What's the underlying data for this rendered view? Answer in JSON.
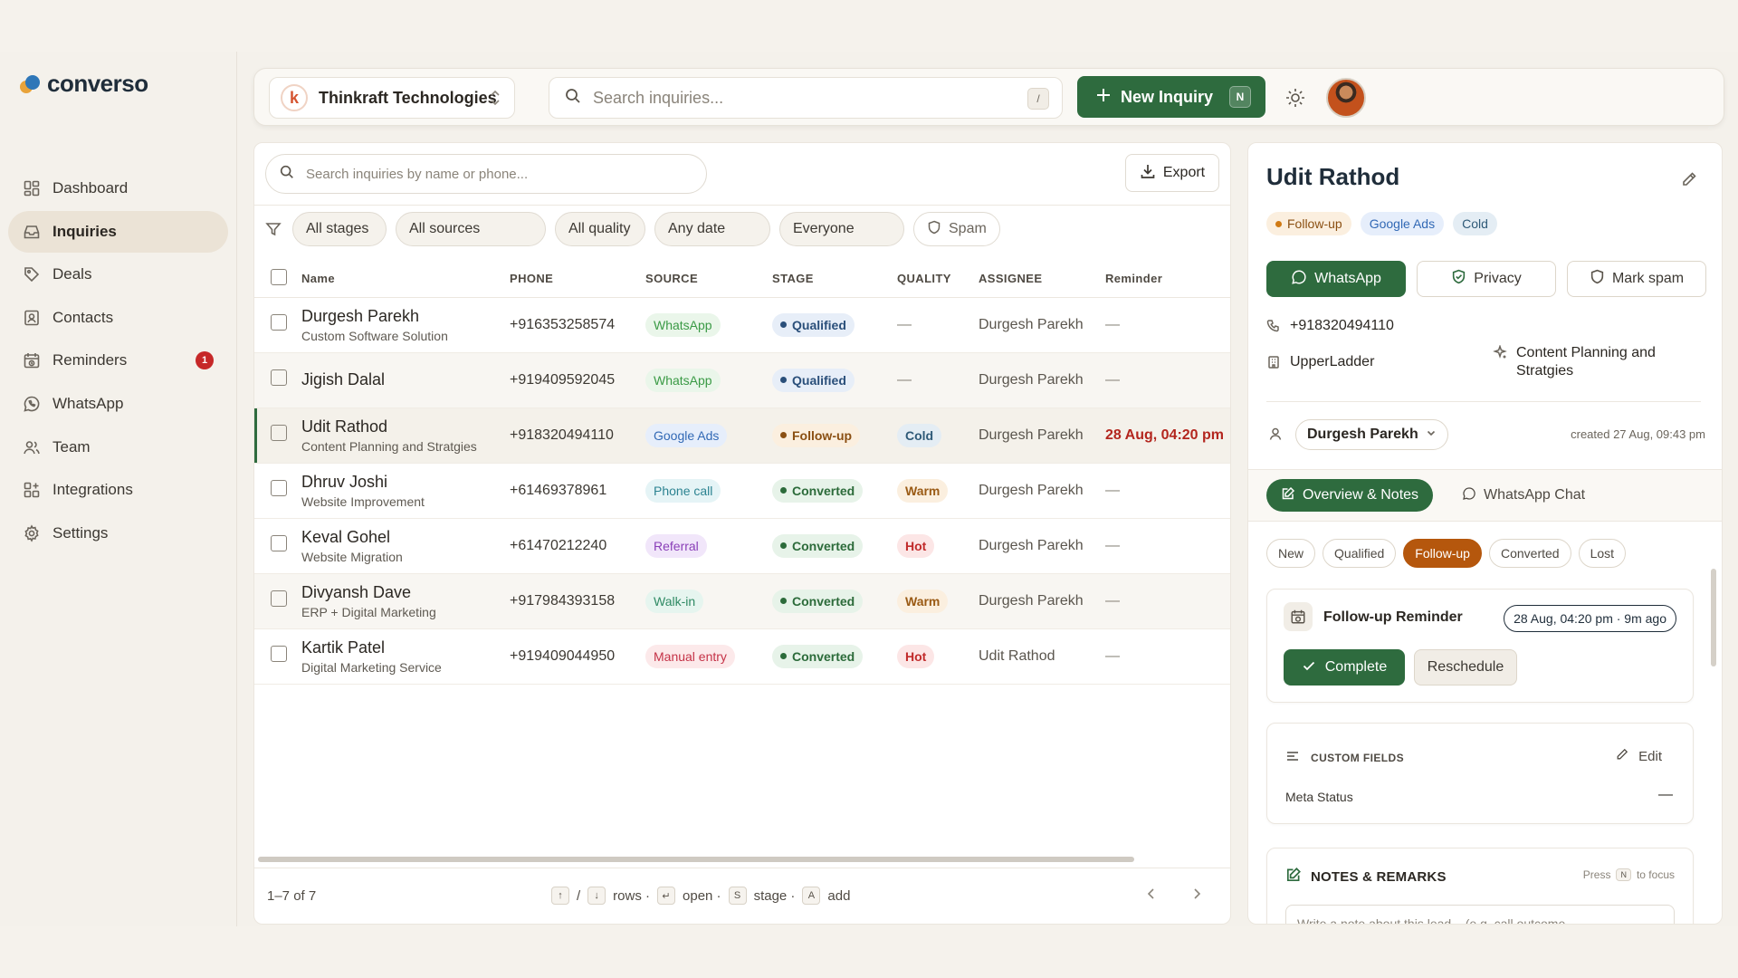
{
  "app": {
    "brand": "converso"
  },
  "sidebar": {
    "items": [
      {
        "label": "Dashboard",
        "icon": "dashboard-icon"
      },
      {
        "label": "Inquiries",
        "icon": "inbox-icon",
        "active": true
      },
      {
        "label": "Deals",
        "icon": "tag-icon"
      },
      {
        "label": "Contacts",
        "icon": "contacts-icon"
      },
      {
        "label": "Reminders",
        "icon": "calendar-clock-icon",
        "badge": "1"
      },
      {
        "label": "WhatsApp",
        "icon": "whatsapp-icon"
      },
      {
        "label": "Team",
        "icon": "team-icon"
      },
      {
        "label": "Integrations",
        "icon": "integrations-icon"
      },
      {
        "label": "Settings",
        "icon": "gear-icon"
      }
    ]
  },
  "topbar": {
    "org_initial": "k",
    "org_name": "Thinkraft Technologies",
    "search_placeholder": "Search inquiries...",
    "search_shortcut": "/",
    "new_inquiry_label": "New Inquiry",
    "new_inquiry_shortcut": "N"
  },
  "list": {
    "search_placeholder": "Search inquiries by name or phone...",
    "export_label": "Export",
    "filters": [
      "All stages",
      "All sources",
      "All quality",
      "Any date",
      "Everyone"
    ],
    "spam_label": "Spam",
    "columns": {
      "name": "Name",
      "phone": "PHONE",
      "source": "SOURCE",
      "stage": "STAGE",
      "quality": "QUALITY",
      "assignee": "ASSIGNEE",
      "reminder": "Reminder"
    },
    "rows": [
      {
        "name": "Durgesh Parekh",
        "subtitle": "Custom Software Solution",
        "phone": "+916353258574",
        "source": "WhatsApp",
        "stage": "Qualified",
        "quality": "—",
        "assignee": "Durgesh Parekh",
        "reminder": "—"
      },
      {
        "name": "Jigish Dalal",
        "subtitle": "",
        "phone": "+919409592045",
        "source": "WhatsApp",
        "stage": "Qualified",
        "quality": "—",
        "assignee": "Durgesh Parekh",
        "reminder": "—"
      },
      {
        "name": "Udit Rathod",
        "subtitle": "Content Planning and Stratgies",
        "phone": "+918320494110",
        "source": "Google Ads",
        "stage": "Follow-up",
        "quality": "Cold",
        "assignee": "Durgesh Parekh",
        "reminder": "28 Aug, 04:20 pm"
      },
      {
        "name": "Dhruv Joshi",
        "subtitle": "Website Improvement",
        "phone": "+61469378961",
        "source": "Phone call",
        "stage": "Converted",
        "quality": "Warm",
        "assignee": "Durgesh Parekh",
        "reminder": "—"
      },
      {
        "name": "Keval Gohel",
        "subtitle": "Website Migration",
        "phone": "+61470212240",
        "source": "Referral",
        "stage": "Converted",
        "quality": "Hot",
        "assignee": "Durgesh Parekh",
        "reminder": "—"
      },
      {
        "name": "Divyansh Dave",
        "subtitle": "ERP + Digital Marketing",
        "phone": "+917984393158",
        "source": "Walk-in",
        "stage": "Converted",
        "quality": "Warm",
        "assignee": "Durgesh Parekh",
        "reminder": "—"
      },
      {
        "name": "Kartik Patel",
        "subtitle": "Digital Marketing Service",
        "phone": "+919409044950",
        "source": "Manual entry",
        "stage": "Converted",
        "quality": "Hot",
        "assignee": "Udit Rathod",
        "reminder": "—"
      }
    ],
    "footer": {
      "count": "1–7 of 7",
      "hint_slash": "/",
      "hint_rows": "rows ·",
      "hint_open": "open ·",
      "hint_stage": "stage ·",
      "hint_add": "add",
      "k_up": "↑",
      "k_down": "↓",
      "k_enter": "↵",
      "k_s": "S",
      "k_a": "A"
    }
  },
  "detail": {
    "name": "Udit Rathod",
    "tags": [
      "Follow-up",
      "Google Ads",
      "Cold"
    ],
    "actions": {
      "whatsapp": "WhatsApp",
      "privacy": "Privacy",
      "mark_spam": "Mark spam"
    },
    "phone": "+918320494110",
    "company": "UpperLadder",
    "service": "Content Planning and Stratgies",
    "assignee": "Durgesh Parekh",
    "created": "created 27 Aug, 09:43 pm",
    "tabs": {
      "overview": "Overview & Notes",
      "chat": "WhatsApp Chat"
    },
    "stages": [
      "New",
      "Qualified",
      "Follow-up",
      "Converted",
      "Lost"
    ],
    "active_stage": "Follow-up",
    "reminder": {
      "title": "Follow-up Reminder",
      "time": "28 Aug, 04:20 pm · 9m ago",
      "complete": "Complete",
      "reschedule": "Reschedule"
    },
    "custom_fields": {
      "title": "CUSTOM FIELDS",
      "edit": "Edit",
      "meta_status_label": "Meta Status",
      "meta_status_value": "—"
    },
    "notes": {
      "title": "NOTES & REMARKS",
      "hint_prefix": "Press",
      "hint_key": "N",
      "hint_suffix": "to focus",
      "placeholder": "Write a note about this lead... (e.g. call outcome,"
    }
  },
  "colors": {
    "primary": "#2e6b3e",
    "followup": "#b5570d",
    "danger": "#b3261e"
  }
}
